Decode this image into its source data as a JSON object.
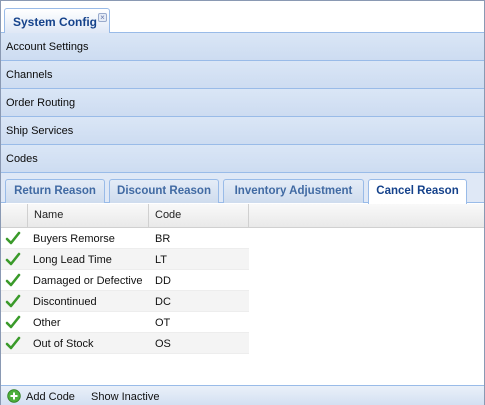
{
  "main_tab": {
    "label": "System Config",
    "close_glyph": "×"
  },
  "panels": [
    {
      "label": "Account Settings"
    },
    {
      "label": "Channels"
    },
    {
      "label": "Order Routing"
    },
    {
      "label": "Ship Services"
    },
    {
      "label": "Codes"
    }
  ],
  "subtabs": [
    {
      "label": "Return Reason",
      "active": false
    },
    {
      "label": "Discount Reason",
      "active": false
    },
    {
      "label": "Inventory Adjustment",
      "active": false
    },
    {
      "label": "Cancel Reason",
      "active": true
    }
  ],
  "grid": {
    "columns": {
      "name": "Name",
      "code": "Code"
    },
    "rows": [
      {
        "name": "Buyers Remorse",
        "code": "BR",
        "active_icon": "check-icon"
      },
      {
        "name": "Long Lead Time",
        "code": "LT",
        "active_icon": "check-icon"
      },
      {
        "name": "Damaged or Defective",
        "code": "DD",
        "active_icon": "check-icon"
      },
      {
        "name": "Discontinued",
        "code": "DC",
        "active_icon": "check-icon"
      },
      {
        "name": "Other",
        "code": "OT",
        "active_icon": "check-icon"
      },
      {
        "name": "Out of Stock",
        "code": "OS",
        "active_icon": "check-icon"
      }
    ]
  },
  "toolbar": {
    "add_label": "Add Code",
    "inactive_label": "Show Inactive"
  },
  "colors": {
    "header_blue": "#15428b",
    "check_green": "#3a9a2a",
    "add_green": "#4caf3a"
  }
}
